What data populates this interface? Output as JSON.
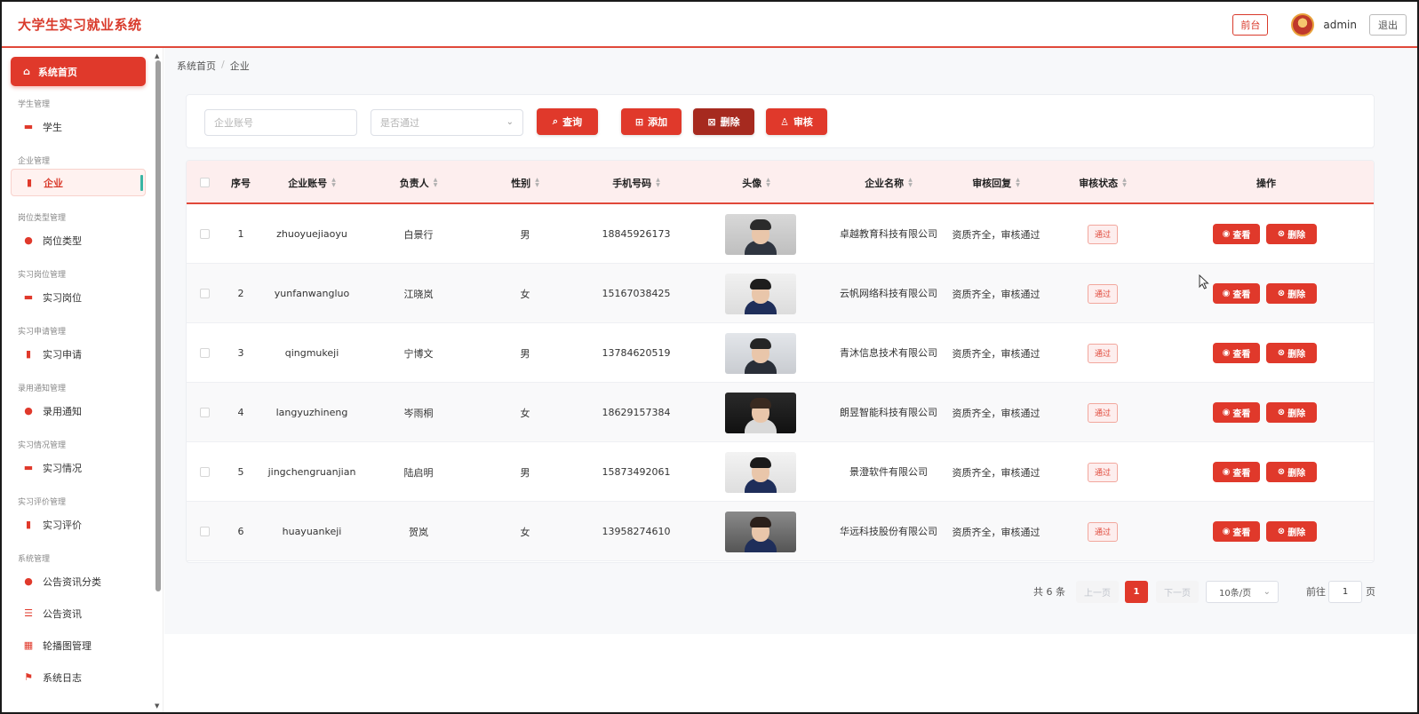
{
  "header": {
    "logo": "大学生实习就业系统",
    "front_label": "前台",
    "user": "admin",
    "logout_label": "退出"
  },
  "sidebar": {
    "home": "系统首页",
    "groups": [
      {
        "title": "学生管理",
        "item": "学生",
        "icon": "briefcase-icon"
      },
      {
        "title": "企业管理",
        "item": "企业",
        "icon": "bar-chart-icon"
      },
      {
        "title": "岗位类型管理",
        "item": "岗位类型",
        "icon": "location-pin-icon"
      },
      {
        "title": "实习岗位管理",
        "item": "实习岗位",
        "icon": "briefcase-icon"
      },
      {
        "title": "实习申请管理",
        "item": "实习申请",
        "icon": "bar-chart-icon"
      },
      {
        "title": "录用通知管理",
        "item": "录用通知",
        "icon": "location-pin-icon"
      },
      {
        "title": "实习情况管理",
        "item": "实习情况",
        "icon": "briefcase-icon"
      },
      {
        "title": "实习评价管理",
        "item": "实习评价",
        "icon": "bar-chart-icon"
      },
      {
        "title": "系统管理",
        "item": "公告资讯分类",
        "icon": "location-pin-icon"
      }
    ],
    "extra_items": [
      {
        "label": "公告资讯",
        "icon": "sliders-icon"
      },
      {
        "label": "轮播图管理",
        "icon": "grid-icon"
      },
      {
        "label": "系统日志",
        "icon": "flag-icon"
      }
    ]
  },
  "breadcrumb": {
    "home": "系统首页",
    "current": "企业"
  },
  "search": {
    "account_placeholder": "企业账号",
    "status_placeholder": "是否通过",
    "query_label": "查询",
    "add_label": "添加",
    "delete_label": "删除",
    "audit_label": "审核"
  },
  "table": {
    "columns": [
      "序号",
      "企业账号",
      "负责人",
      "性别",
      "手机号码",
      "头像",
      "企业名称",
      "审核回复",
      "审核状态",
      "操作"
    ],
    "rows": [
      {
        "no": "1",
        "account": "zhuoyuejiaoyu",
        "leader": "白景行",
        "gender": "男",
        "phone": "18845926173",
        "company": "卓越教育科技有限公司",
        "reply": "资质齐全，审核通过",
        "status": "通过"
      },
      {
        "no": "2",
        "account": "yunfanwangluo",
        "leader": "江晓岚",
        "gender": "女",
        "phone": "15167038425",
        "company": "云帆网络科技有限公司",
        "reply": "资质齐全，审核通过",
        "status": "通过"
      },
      {
        "no": "3",
        "account": "qingmukeji",
        "leader": "宁博文",
        "gender": "男",
        "phone": "13784620519",
        "company": "青沐信息技术有限公司",
        "reply": "资质齐全，审核通过",
        "status": "通过"
      },
      {
        "no": "4",
        "account": "langyuzhineng",
        "leader": "岑雨桐",
        "gender": "女",
        "phone": "18629157384",
        "company": "朗昱智能科技有限公司",
        "reply": "资质齐全，审核通过",
        "status": "通过"
      },
      {
        "no": "5",
        "account": "jingchengruanjian",
        "leader": "陆启明",
        "gender": "男",
        "phone": "15873492061",
        "company": "景澄软件有限公司",
        "reply": "资质齐全，审核通过",
        "status": "通过"
      },
      {
        "no": "6",
        "account": "huayuankeji",
        "leader": "贺岚",
        "gender": "女",
        "phone": "13958274610",
        "company": "华远科技股份有限公司",
        "reply": "资质齐全，审核通过",
        "status": "通过"
      }
    ],
    "view_label": "查看",
    "delete_label": "删除"
  },
  "pagination": {
    "total": "共 6 条",
    "prev": "上一页",
    "page": "1",
    "next": "下一页",
    "size": "10条/页",
    "goto": "前往",
    "goto_value": "1",
    "page_suffix": "页"
  },
  "colors": {
    "accent": "#e0392b",
    "dark_accent": "#a62a1f"
  }
}
